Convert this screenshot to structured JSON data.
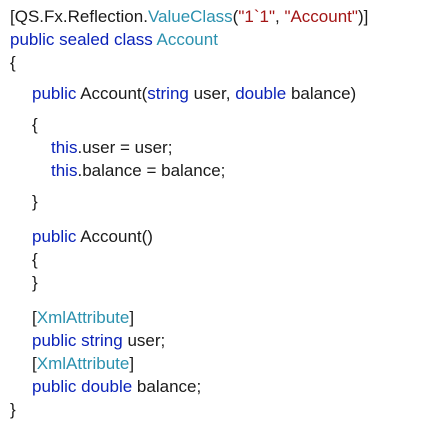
{
  "colors": {
    "keyword": "#0a22b9",
    "type": "#2b91af",
    "string": "#a31515",
    "text": "#1a1a1a",
    "background": "#ffffff"
  },
  "lines": {
    "l1": {
      "a": "[QS.Fx.Reflection.",
      "b": "ValueClass",
      "c": "(",
      "d": "\"1`1\"",
      "e": ", ",
      "f": "\"Account\"",
      "g": ")]"
    },
    "l2": {
      "a": "public sealed class",
      "b": " ",
      "c": "Account"
    },
    "l3": {
      "a": "{"
    },
    "l4": {
      "a": "public",
      "b": " Account(",
      "c": "string",
      "d": " user, ",
      "e": "double",
      "f": " balance)"
    },
    "l5": {
      "a": "{"
    },
    "l6": {
      "a": "this",
      "b": ".user = user;"
    },
    "l7": {
      "a": "this",
      "b": ".balance = balance;"
    },
    "l8": {
      "a": "}"
    },
    "l9": {
      "a": "public",
      "b": " Account()"
    },
    "l10": {
      "a": "{"
    },
    "l11": {
      "a": "}"
    },
    "l12": {
      "a": "[",
      "b": "XmlAttribute",
      "c": "]"
    },
    "l13": {
      "a": "public string",
      "b": " user;"
    },
    "l14": {
      "a": "[",
      "b": "XmlAttribute",
      "c": "]"
    },
    "l15": {
      "a": "public double",
      "b": " balance;"
    },
    "l16": {
      "a": "}"
    }
  }
}
